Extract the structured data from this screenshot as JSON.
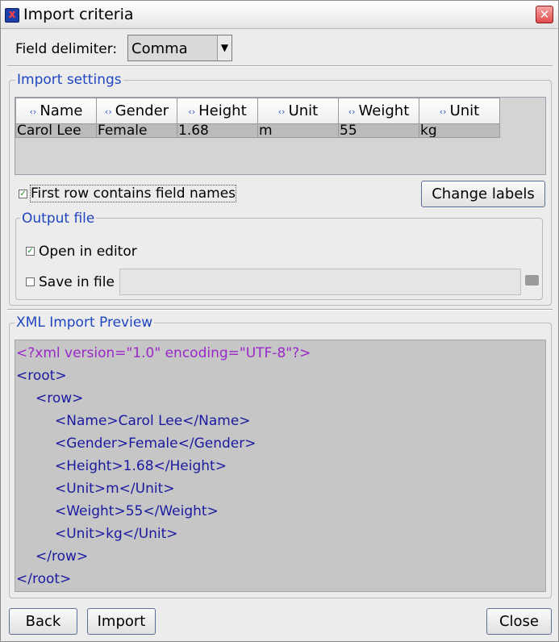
{
  "window": {
    "title": "Import criteria"
  },
  "delimiter": {
    "label": "Field delimiter:",
    "selected": "Comma"
  },
  "import_settings": {
    "legend": "Import settings",
    "columns": [
      "Name",
      "Gender",
      "Height",
      "Unit",
      "Weight",
      "Unit"
    ],
    "rows": [
      [
        "Carol Lee",
        "Female",
        "1.68",
        "m",
        "55",
        "kg"
      ]
    ],
    "first_row_label": "First row contains field names",
    "first_row_checked": true,
    "change_labels_button": "Change labels"
  },
  "output_file": {
    "legend": "Output file",
    "open_in_editor_label": "Open in editor",
    "open_in_editor_checked": true,
    "save_in_file_label": "Save in file",
    "save_in_file_checked": false,
    "file_path": ""
  },
  "preview": {
    "legend": "XML Import Preview",
    "lines": [
      "<?xml version=\"1.0\" encoding=\"UTF-8\"?>",
      "<root>",
      "<row>",
      "<Name>Carol Lee</Name>",
      "<Gender>Female</Gender>",
      "<Height>1.68</Height>",
      "<Unit>m</Unit>",
      "<Weight>55</Weight>",
      "<Unit>kg</Unit>",
      "</row>",
      "</root>"
    ]
  },
  "buttons": {
    "back": "Back",
    "import": "Import",
    "close": "Close"
  },
  "colors": {
    "legend": "#1f45c0",
    "xml_declaration": "#9a27c8",
    "xml_tag": "#1a1aa0"
  }
}
